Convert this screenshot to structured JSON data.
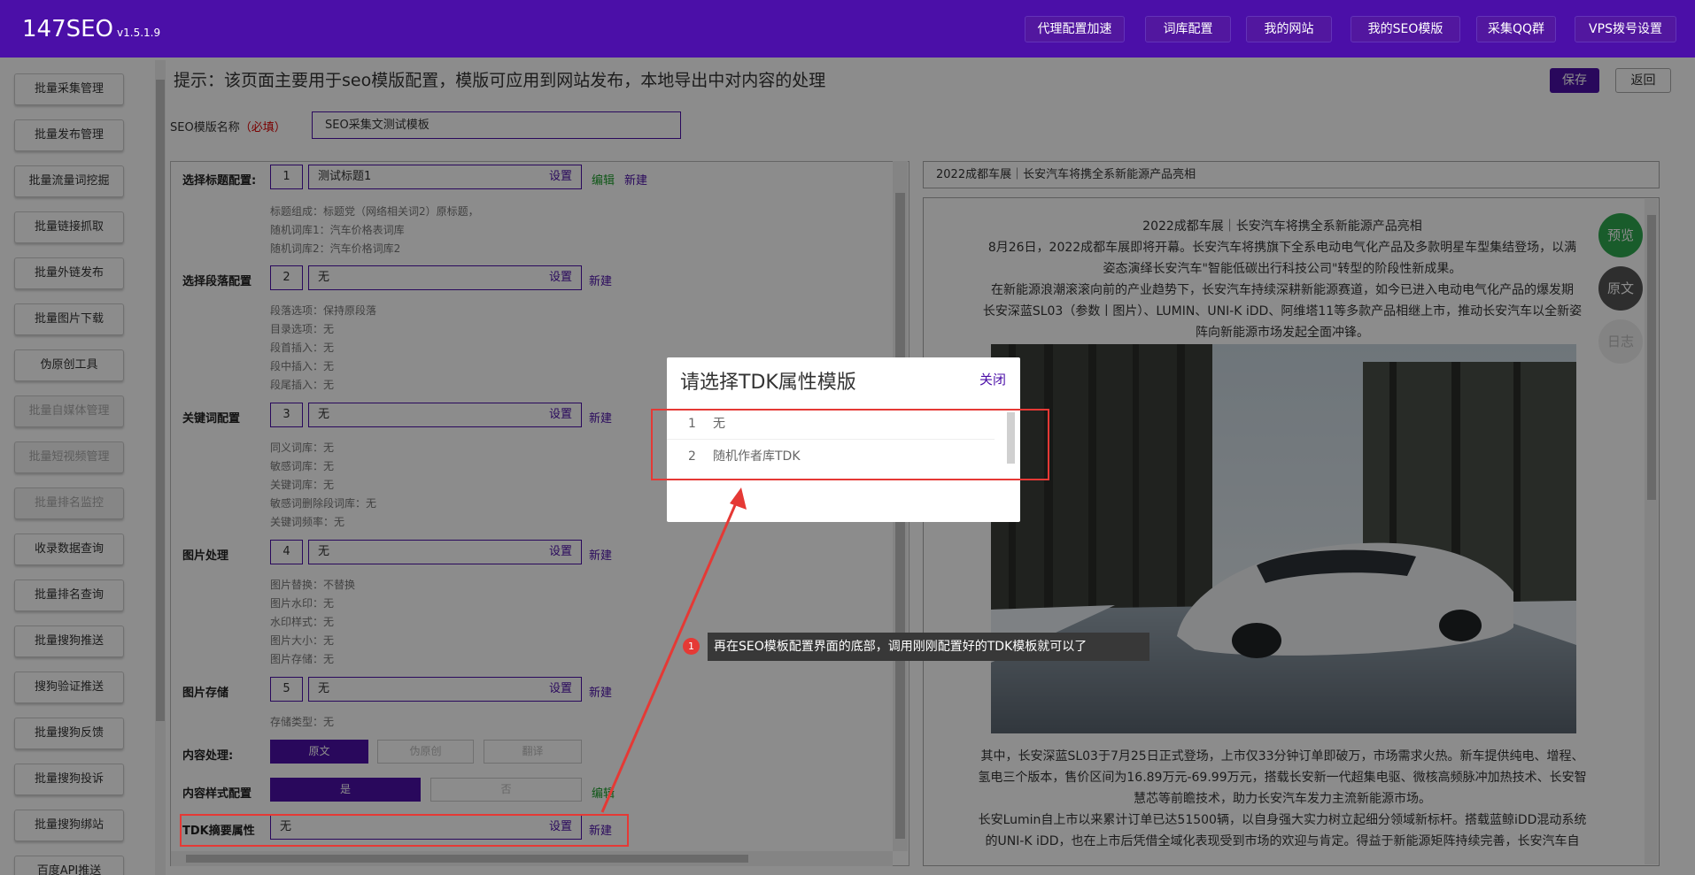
{
  "app": {
    "name": "147SEO",
    "version": "v1.5.1.9"
  },
  "nav": [
    "代理配置加速",
    "词库配置",
    "我的网站",
    "我的SEO模版",
    "采集QQ群",
    "VPS拨号设置"
  ],
  "sidebar": [
    "批量采集管理",
    "批量发布管理",
    "批量流量词挖掘",
    "批量链接抓取",
    "批量外链发布",
    "批量图片下载",
    "伪原创工具",
    "批量自媒体管理",
    "批量短视频管理",
    "批量排名监控",
    "收录数据查询",
    "批量排名查询",
    "批量搜狗推送",
    "搜狗验证推送",
    "批量搜狗反馈",
    "批量搜狗投诉",
    "批量搜狗绑站",
    "百度API推送"
  ],
  "hint": "提示：该页面主要用于seo模版配置，模版可应用到网站发布，本地导出中对内容的处理",
  "buttons": {
    "save": "保存",
    "back": "返回"
  },
  "name_field": {
    "label": "SEO模版名称",
    "required": "（必填）",
    "value": "SEO采集文测试模板"
  },
  "config": {
    "title": {
      "label": "选择标题配置:",
      "num": "1",
      "value": "测试标题1",
      "set": "设置",
      "edit": "编辑",
      "new": "新建",
      "details": [
        "标题组成：标题党（网络相关词2）原标题，",
        "随机词库1：汽车价格表词库",
        "随机词库2：汽车价格词库2"
      ]
    },
    "para": {
      "label": "选择段落配置",
      "num": "2",
      "value": "无",
      "set": "设置",
      "new": "新建",
      "details": [
        "段落选项：保持原段落",
        "目录选项：无",
        "段首插入：无",
        "段中插入：无",
        "段尾插入：无"
      ]
    },
    "kw": {
      "label": "关键词配置",
      "num": "3",
      "value": "无",
      "set": "设置",
      "new": "新建",
      "details": [
        "同义词库：无",
        "敏感词库：无",
        "关键词库：无",
        "敏感词删除段词库：无",
        "关键词频率：无"
      ]
    },
    "img": {
      "label": "图片处理",
      "num": "4",
      "value": "无",
      "set": "设置",
      "new": "新建",
      "details": [
        "图片替换：不替换",
        "图片水印：无",
        "水印样式：无",
        "图片大小：无",
        "图片存储：无"
      ]
    },
    "store": {
      "label": "图片存储",
      "num": "5",
      "value": "无",
      "set": "设置",
      "new": "新建",
      "details": [
        "存储类型：无"
      ]
    },
    "content": {
      "label": "内容处理:",
      "opts": [
        "原文",
        "伪原创",
        "翻译"
      ]
    },
    "style": {
      "label": "内容样式配置",
      "opts": [
        "是",
        "否"
      ],
      "edit": "编辑"
    },
    "tdk": {
      "label": "TDK摘要属性",
      "value": "无",
      "set": "设置",
      "new": "新建"
    }
  },
  "preview": {
    "title_bar": "2022成都车展｜长安汽车将携全系新能源产品亮相",
    "para_top": [
      "2022成都车展｜长安汽车将携全系新能源产品亮相",
      "8月26日，2022成都车展即将开幕。长安汽车将携旗下全系电动电气化产品及多款明星车型集结登场，以满",
      "姿态演绎长安汽车\"智能低碳出行科技公司\"转型的阶段性新成果。",
      "在新能源浪潮滚滚向前的产业趋势下，长安汽车持续深耕新能源赛道，如今已进入电动电气化产品的爆发期",
      "长安深蓝SL03（参数丨图片）、LUMIN、UNI-K iDD、阿维塔11等多款产品相继上市，推动长安汽车以全新姿",
      "阵向新能源市场发起全面冲锋。"
    ],
    "para_bottom": [
      "其中，长安深蓝SL03于7月25日正式登场，上市仅33分钟订单即破万，市场需求火热。新车提供纯电、增程、",
      "氢电三个版本，售价区间为16.89万元-69.99万元，搭载长安新一代超集电驱、微核高频脉冲加热技术、长安智",
      "慧芯等前瞻技术，助力长安汽车发力主流新能源市场。",
      "长安Lumin自上市以来累计订单已达51500辆，以自身强大实力树立起细分领域新标杆。搭载蓝鲸iDD混动系统",
      "的UNI-K iDD，也在上市后凭借全域化表现受到市场的欢迎与肯定。得益于新能源矩阵持续完善，长安汽车自"
    ]
  },
  "side_buttons": {
    "preview": "预览",
    "original": "原文",
    "log": "日志"
  },
  "modal": {
    "title": "请选择TDK属性模版",
    "close": "关闭",
    "options": [
      {
        "n": "1",
        "t": "无"
      },
      {
        "n": "2",
        "t": "随机作者库TDK"
      }
    ]
  },
  "tooltip": {
    "num": "1",
    "text": "再在SEO模板配置界面的底部，调用刚刚配置好的TDK模板就可以了"
  }
}
